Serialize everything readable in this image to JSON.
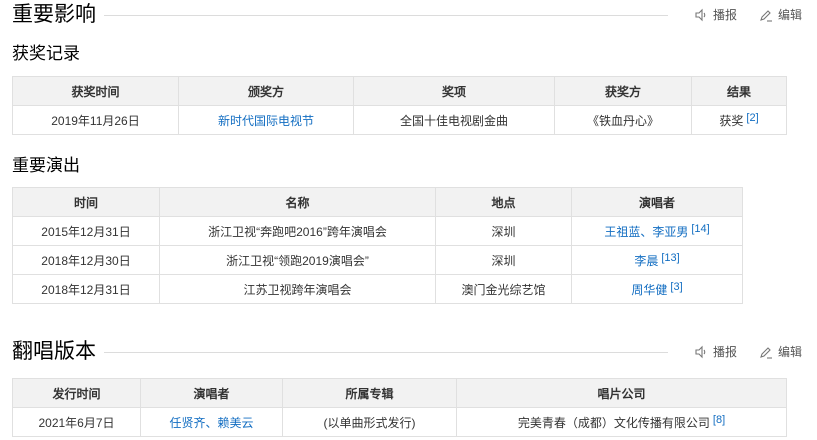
{
  "section_influence": {
    "title": "重要影响",
    "actions": {
      "broadcast": "播报",
      "edit": "编辑"
    }
  },
  "awards": {
    "title": "获奖记录",
    "headers": [
      "获奖时间",
      "颁奖方",
      "奖项",
      "获奖方",
      "结果"
    ],
    "rows": [
      {
        "time": "2019年11月26日",
        "issuer": "新时代国际电视节",
        "award": "全国十佳电视剧金曲",
        "winner": "《铁血丹心》",
        "result": "获奖",
        "ref": "[2]"
      }
    ]
  },
  "performances": {
    "title": "重要演出",
    "headers": [
      "时间",
      "名称",
      "地点",
      "演唱者"
    ],
    "rows": [
      {
        "time": "2015年12月31日",
        "name": "浙江卫视“奔跑吧2016”跨年演唱会",
        "place": "深圳",
        "singer": "王祖蓝、李亚男",
        "ref": "[14]"
      },
      {
        "time": "2018年12月30日",
        "name": "浙江卫视“领跑2019演唱会”",
        "place": "深圳",
        "singer": "李晨",
        "ref": "[13]"
      },
      {
        "time": "2018年12月31日",
        "name": "江苏卫视跨年演唱会",
        "place": "澳门金光综艺馆",
        "singer": "周华健",
        "ref": "[3]"
      }
    ]
  },
  "covers": {
    "title": "翻唱版本",
    "actions": {
      "broadcast": "播报",
      "edit": "编辑"
    },
    "headers": [
      "发行时间",
      "演唱者",
      "所属专辑",
      "唱片公司"
    ],
    "rows": [
      {
        "time": "2021年6月7日",
        "singer": "任贤齐、赖美云",
        "album": "(以单曲形式发行)",
        "label": "完美青春（成都）文化传播有限公司",
        "ref": "[8]"
      }
    ]
  }
}
